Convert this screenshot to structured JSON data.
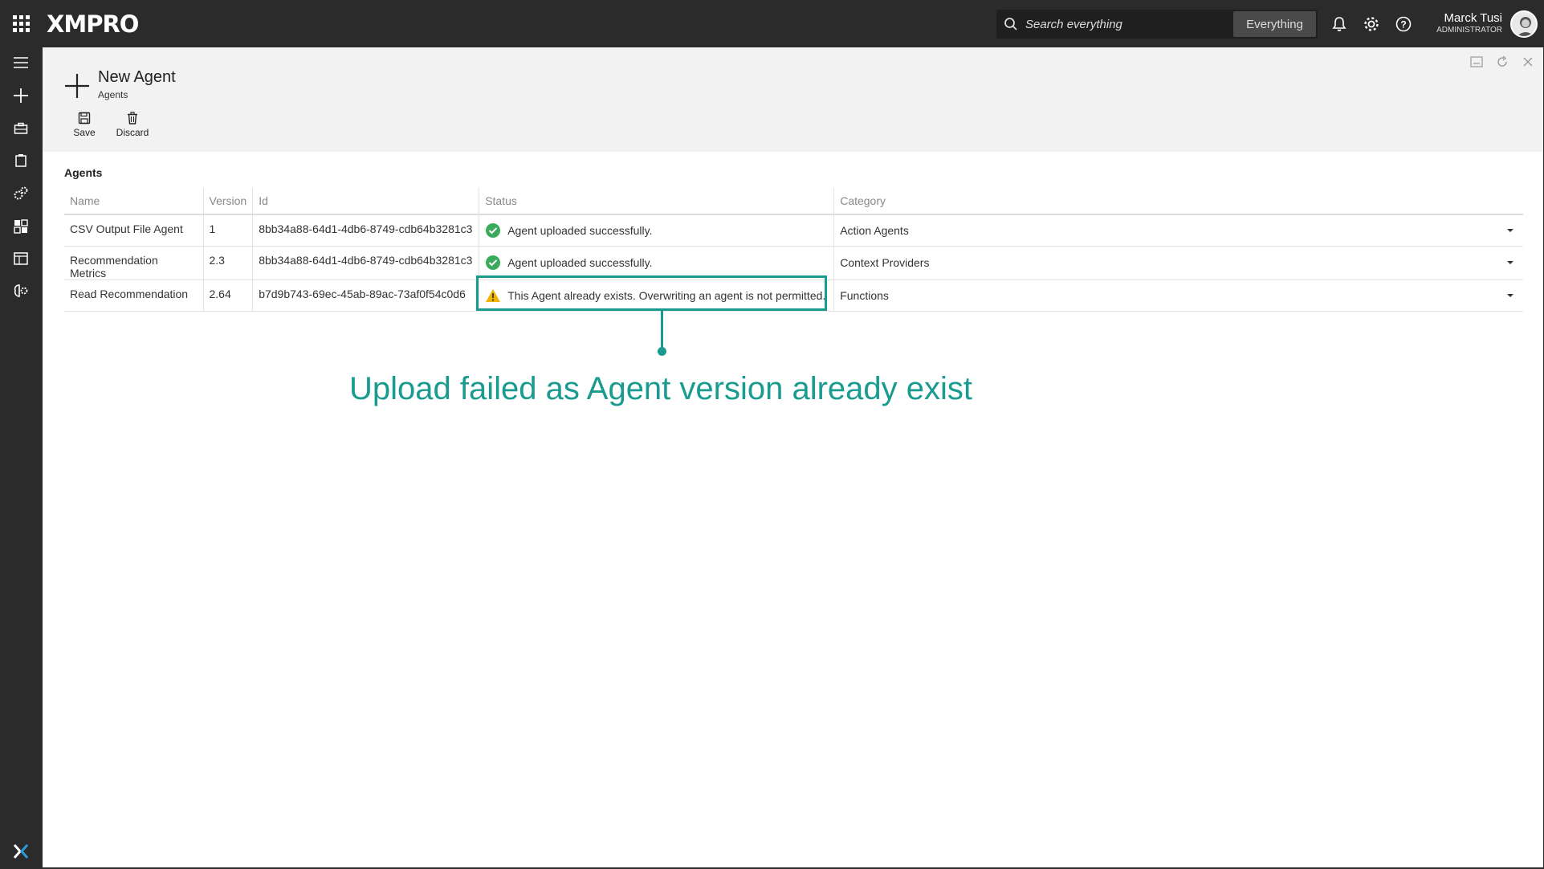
{
  "app": {
    "brand": "XMPRO",
    "search_placeholder": "Search everything",
    "search_scope": "Everything",
    "user_name": "Marck Tusi",
    "user_role": "ADMINISTRATOR"
  },
  "page": {
    "title": "New Agent",
    "subtitle": "Agents"
  },
  "toolbar": {
    "save_label": "Save",
    "discard_label": "Discard"
  },
  "section": {
    "title": "Agents"
  },
  "table": {
    "headers": {
      "name": "Name",
      "version": "Version",
      "id": "Id",
      "status": "Status",
      "category": "Category"
    },
    "rows": [
      {
        "name": "CSV Output File Agent",
        "version": "1",
        "id": "8bb34a88-64d1-4db6-8749-cdb64b3281c3",
        "status": "Agent uploaded successfully.",
        "status_icon": "success-check-icon",
        "category": "Action Agents"
      },
      {
        "name": "Recommendation Metrics",
        "version": "2.3",
        "id": "8bb34a88-64d1-4db6-8749-cdb64b3281c3",
        "status": "Agent uploaded successfully.",
        "status_icon": "success-check-icon",
        "category": "Context Providers"
      },
      {
        "name": "Read Recommendation",
        "version": "2.64",
        "id": "b7d9b743-69ec-45ab-89ac-73af0f54c0d6",
        "status": "This Agent already exists. Overwriting an agent is not permitted.",
        "status_icon": "warning-icon",
        "category": "Functions"
      }
    ]
  },
  "annotation": {
    "text": "Upload failed as Agent version already exist",
    "color": "#1a9b8f"
  },
  "colors": {
    "chrome": "#2b2b2b",
    "success": "#3aaa5c",
    "warning": "#f0b400",
    "accent": "#1a9b8f"
  }
}
